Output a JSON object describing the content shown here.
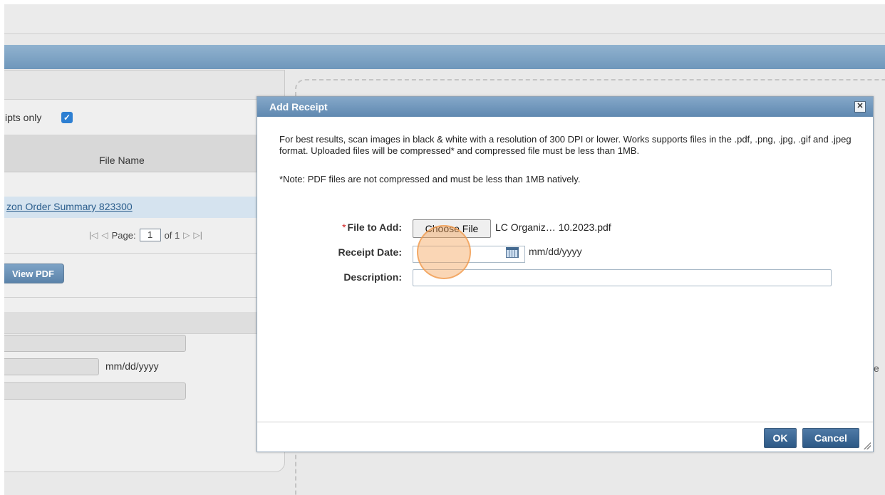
{
  "background": {
    "receipts_only_label": "ipts only",
    "file_name_header": "File Name",
    "row_link": "zon Order Summary 823300",
    "pager": {
      "label": "Page:",
      "value": "1",
      "of": "of 1"
    },
    "view_pdf_label": "View PDF",
    "date_hint": "mm/dd/yyyy",
    "edge_text": "e"
  },
  "dialog": {
    "title": "Add Receipt",
    "close_icon": "close-icon",
    "info_text": "For best results, scan images in black & white with a resolution of 300 DPI or lower. Works supports files in the .pdf, .png, .jpg, .gif and .jpeg format. Uploaded files will be compressed* and compressed file must be less than 1MB.",
    "note_text": "*Note: PDF files are not compressed and must be less than 1MB natively.",
    "fields": {
      "file_label": "File to Add:",
      "choose_file_label": "Choose File",
      "file_name": "LC Organiz… 10.2023.pdf",
      "date_label": "Receipt Date:",
      "date_value": "",
      "date_hint": "mm/dd/yyyy",
      "description_label": "Description:",
      "description_value": ""
    },
    "ok_label": "OK",
    "cancel_label": "Cancel"
  },
  "colors": {
    "accent": "#5f88b0",
    "button": "#2d5986",
    "click_marker": "#f5a55a"
  }
}
